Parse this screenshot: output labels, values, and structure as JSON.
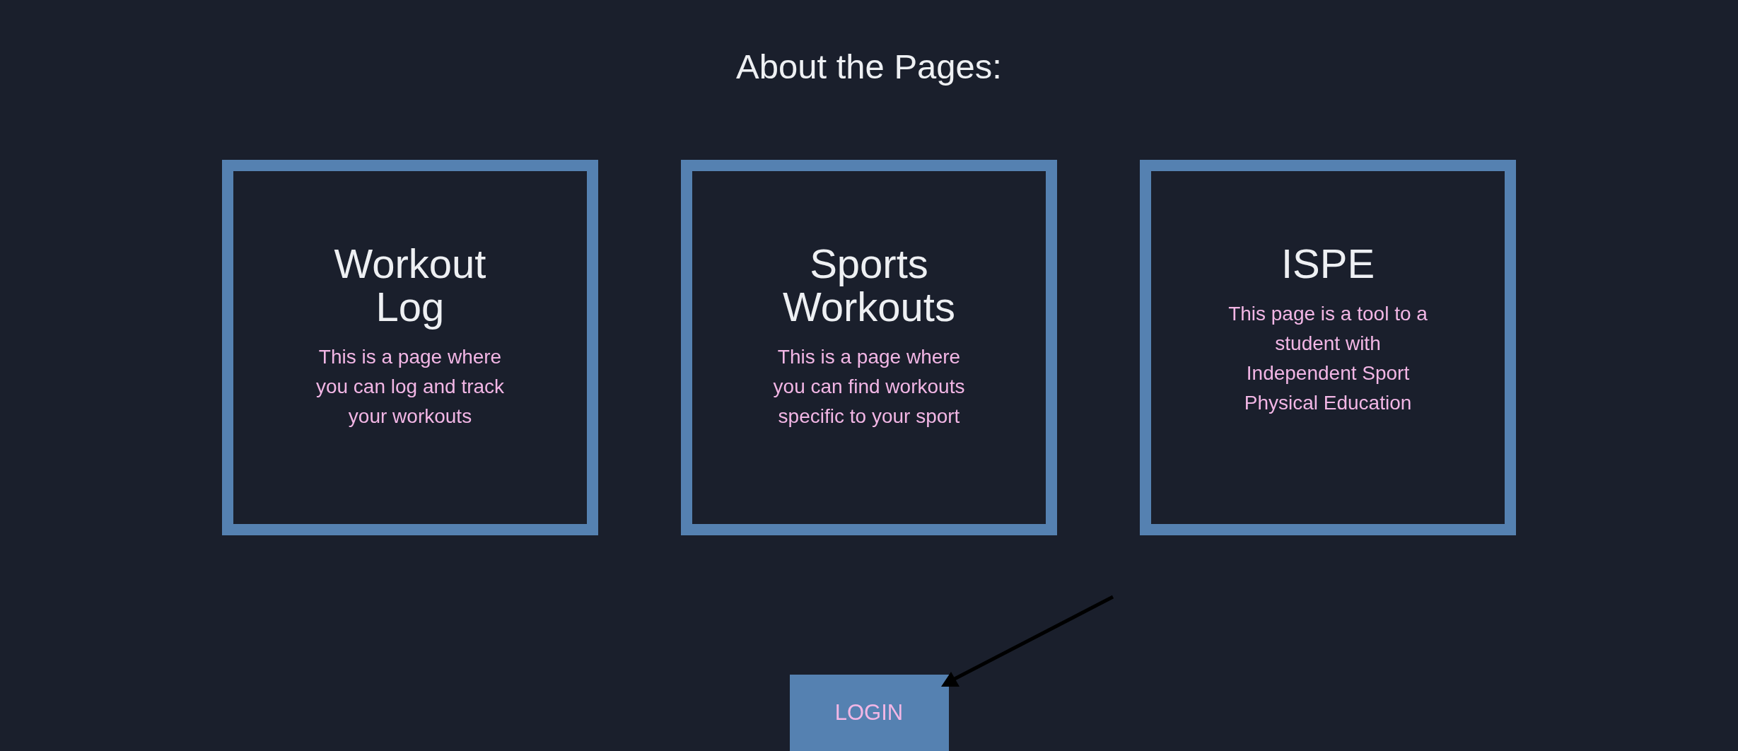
{
  "title": "About the Pages:",
  "cards": [
    {
      "heading": "Workout\nLog",
      "description": "This is a page where\nyou can log and track\nyour workouts"
    },
    {
      "heading": "Sports\nWorkouts",
      "description": "This is a page where\nyou can find workouts\nspecific to your sport"
    },
    {
      "heading": "ISPE",
      "description": "This page is a tool to a\nstudent with\nIndependent Sport\nPhysical Education"
    }
  ],
  "login_button": {
    "label": "LOGIN"
  }
}
